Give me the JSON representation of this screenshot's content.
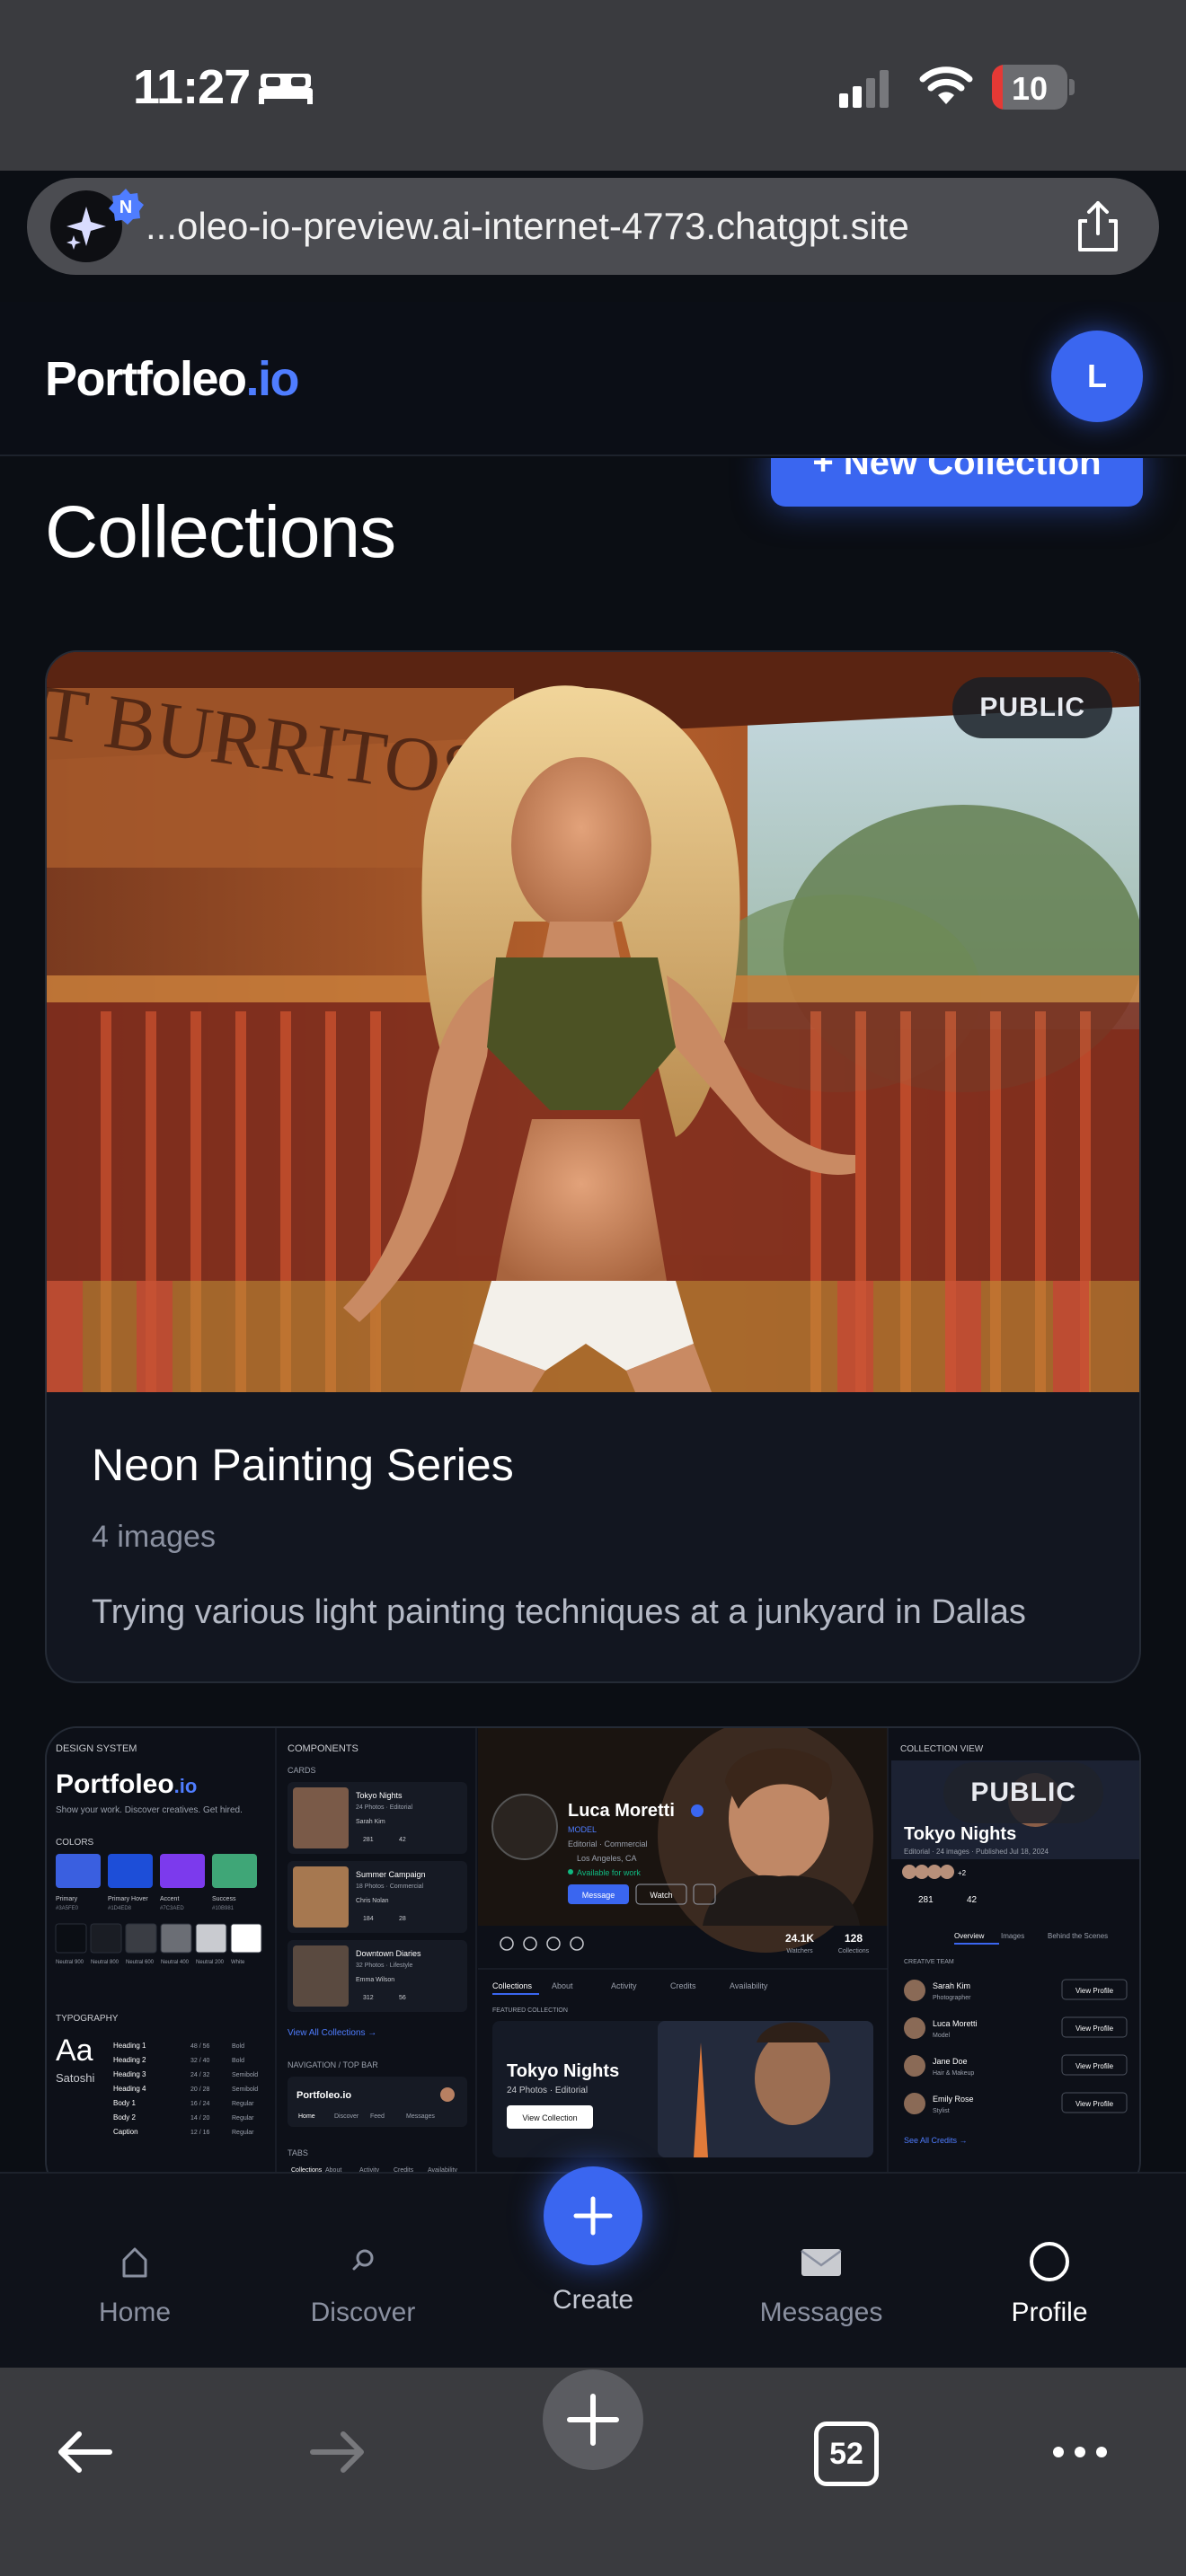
{
  "status_bar": {
    "time": "11:27",
    "battery_level": "10",
    "battery_fraction": 0.1
  },
  "browser": {
    "url": "...oleo-io-preview.ai-internet-4773.chatgpt.site",
    "badge_letter": "N",
    "tabs_count": "52"
  },
  "header": {
    "logo_main": "Portfoleo",
    "logo_suffix": ".io",
    "avatar_initial": "L"
  },
  "page": {
    "title": "Collections",
    "new_collection_label": "+ New Collection"
  },
  "collections": [
    {
      "title": "Neon Painting Series",
      "count": "4 images",
      "description": "Trying various light painting techniques at a junkyard in Dallas",
      "visibility": "PUBLIC",
      "photo_sign_text": "T BURRITOS"
    },
    {
      "visibility": "PUBLIC",
      "preview": {
        "design_system_label": "DESIGN SYSTEM",
        "brand": "Portfoleo",
        "brand_suffix": ".io",
        "tagline": "Show your work. Discover creatives. Get hired.",
        "colors_label": "COLORS",
        "swatches": [
          {
            "name": "Primary",
            "hex": "#3A5FE0",
            "color": "#3a5fe0"
          },
          {
            "name": "Primary Hover",
            "hex": "#1D4ED8",
            "color": "#1d4ed8"
          },
          {
            "name": "Accent",
            "hex": "#7C3AED",
            "color": "#7c3aed"
          },
          {
            "name": "Success",
            "hex": "#10B981",
            "color": "#3fa677"
          }
        ],
        "neutrals": [
          {
            "name": "Neutral 900",
            "color": "#0b0e14"
          },
          {
            "name": "Neutral 800",
            "color": "#1a1d24"
          },
          {
            "name": "Neutral 600",
            "color": "#3a3d44"
          },
          {
            "name": "Neutral 400",
            "color": "#6b6e75"
          },
          {
            "name": "Neutral 200",
            "color": "#c9cbd0"
          },
          {
            "name": "White",
            "color": "#ffffff"
          }
        ],
        "typography_label": "TYPOGRAPHY",
        "typeface_sample": "Aa",
        "typeface_name": "Satoshi",
        "type_scale": [
          {
            "name": "Heading 1",
            "size": "48 / 56",
            "weight": "Bold"
          },
          {
            "name": "Heading 2",
            "size": "32 / 40",
            "weight": "Bold"
          },
          {
            "name": "Heading 3",
            "size": "24 / 32",
            "weight": "Semibold"
          },
          {
            "name": "Heading 4",
            "size": "20 / 28",
            "weight": "Semibold"
          },
          {
            "name": "Body 1",
            "size": "16 / 24",
            "weight": "Regular"
          },
          {
            "name": "Body 2",
            "size": "14 / 20",
            "weight": "Regular"
          },
          {
            "name": "Caption",
            "size": "12 / 16",
            "weight": "Regular"
          }
        ],
        "components_label": "COMPONENTS",
        "cards_label": "CARDS",
        "cards": [
          {
            "title": "Tokyo Nights",
            "meta": "24 Photos · Editorial",
            "author": "Sarah Kim",
            "likes": "281",
            "comments": "42"
          },
          {
            "title": "Summer Campaign",
            "meta": "18 Photos · Commercial",
            "author": "Chris Nolan",
            "likes": "184",
            "comments": "28"
          },
          {
            "title": "Downtown Diaries",
            "meta": "32 Photos · Lifestyle",
            "author": "Emma Wilson",
            "likes": "312",
            "comments": "56"
          }
        ],
        "view_all_collections": "View All Collections →",
        "nav_label": "NAVIGATION / TOP BAR",
        "nav_brand": "Portfoleo.io",
        "nav_items": [
          "Home",
          "Discover",
          "Feed",
          "Messages"
        ],
        "tabs_label": "TABS",
        "tabs_items": [
          "Collections",
          "About",
          "Activity",
          "Credits",
          "Availability"
        ],
        "profile": {
          "name": "Luca Moretti",
          "role": "MODEL",
          "tags": "Editorial · Commercial",
          "location": "Los Angeles, CA",
          "availability": "Available for work",
          "message_label": "Message",
          "watch_label": "Watch",
          "watchers": "24.1K",
          "watchers_label": "Watchers",
          "collections_count": "128",
          "collections_label": "Collections",
          "tabs": [
            "Collections",
            "About",
            "Activity",
            "Credits",
            "Availability"
          ],
          "featured_label": "FEATURED COLLECTION",
          "featured_title": "Tokyo Nights",
          "featured_meta": "24 Photos · Editorial",
          "featured_button": "View Collection"
        },
        "collection_view": {
          "label": "COLLECTION VIEW",
          "title": "Tokyo Nights",
          "meta": "Editorial · 24 images · Published Jul 18, 2024",
          "extra_count": "+2",
          "likes": "281",
          "comments": "42",
          "tabs": [
            "Overview",
            "Images",
            "Behind the Scenes"
          ],
          "team_label": "CREATIVE TEAM",
          "team": [
            {
              "name": "Sarah Kim",
              "role": "Photographer"
            },
            {
              "name": "Luca Moretti",
              "role": "Model"
            },
            {
              "name": "Jane Doe",
              "role": "Hair & Makeup"
            },
            {
              "name": "Emily Rose",
              "role": "Stylist"
            }
          ],
          "view_profile_label": "View Profile",
          "see_all_credits": "See All Credits →"
        }
      }
    }
  ],
  "tab_bar": {
    "home": "Home",
    "discover": "Discover",
    "create": "Create",
    "messages": "Messages",
    "profile": "Profile",
    "active": "Profile"
  },
  "colors": {
    "accent": "#3a66f0",
    "background": "#0b0e14",
    "card": "#121620",
    "battery_low": "#e53935"
  },
  "icons": [
    "bed-icon",
    "signal-icon",
    "wifi-icon",
    "battery-icon",
    "sparkle-icon",
    "share-icon",
    "home-icon",
    "search-icon",
    "plus-icon",
    "mail-icon",
    "profile-icon",
    "back-arrow-icon",
    "forward-arrow-icon",
    "more-icon"
  ]
}
